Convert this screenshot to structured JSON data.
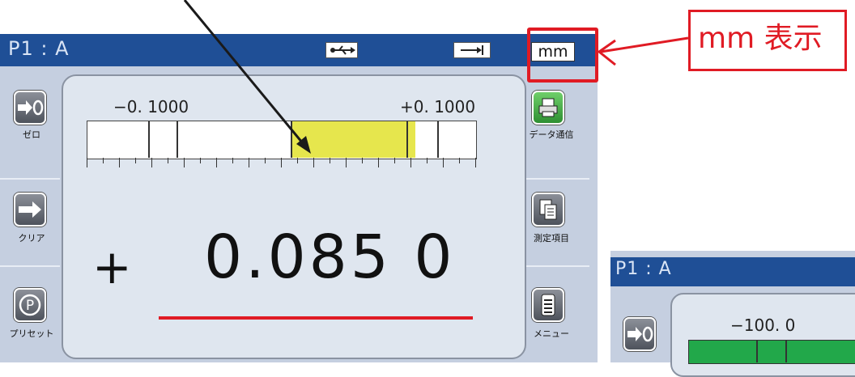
{
  "titlebar": {
    "program": "P1 : A",
    "unit": "mm",
    "usb_icon": "usb-icon",
    "hold_icon": "arrow-hold-icon"
  },
  "sidebar_left": [
    {
      "label": "ゼロ",
      "icon": "zero-arrow-icon",
      "glyph": "➜0"
    },
    {
      "label": "クリア",
      "icon": "clear-arrow-icon",
      "glyph": "➜"
    },
    {
      "label": "プリセット",
      "icon": "preset-p-icon",
      "glyph": "P"
    }
  ],
  "sidebar_right": [
    {
      "label": "データ通信",
      "icon": "printer-icon",
      "glyph": "🖶"
    },
    {
      "label": "測定項目",
      "icon": "documents-icon",
      "glyph": "▤"
    },
    {
      "label": "メニュー",
      "icon": "menu-list-icon",
      "glyph": "☰"
    }
  ],
  "tolerance": {
    "lower": "−0. 1000",
    "upper": "+0. 1000"
  },
  "reading": {
    "sign": "+",
    "value": "0.085 0"
  },
  "annotation": {
    "text": "mm 表示",
    "color": "#e01b24"
  },
  "second_device": {
    "program": "P1 : A",
    "lower": "−100. 0"
  },
  "colors": {
    "titlebar": "#1f4f96",
    "band": "#e6e64d",
    "panel": "#c5cfe0"
  }
}
